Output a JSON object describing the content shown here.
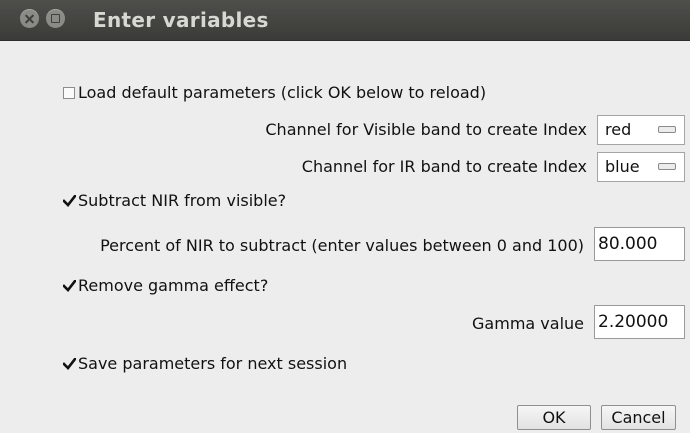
{
  "window": {
    "title": "Enter variables"
  },
  "form": {
    "load_default": {
      "label": "Load default parameters (click OK below to reload)",
      "checked": false
    },
    "visible_channel": {
      "label": "Channel for Visible band to create Index",
      "value": "red"
    },
    "ir_channel": {
      "label": "Channel for IR band to create Index",
      "value": "blue"
    },
    "subtract_nir": {
      "label": "Subtract NIR from visible?",
      "checked": true
    },
    "percent_nir": {
      "label": "Percent of NIR to subtract (enter values between 0 and 100)",
      "value": "80.000"
    },
    "remove_gamma": {
      "label": "Remove gamma effect?",
      "checked": true
    },
    "gamma": {
      "label": "Gamma value",
      "value": "2.20000"
    },
    "save_params": {
      "label": "Save parameters for next session",
      "checked": true
    }
  },
  "buttons": {
    "ok": "OK",
    "cancel": "Cancel"
  }
}
